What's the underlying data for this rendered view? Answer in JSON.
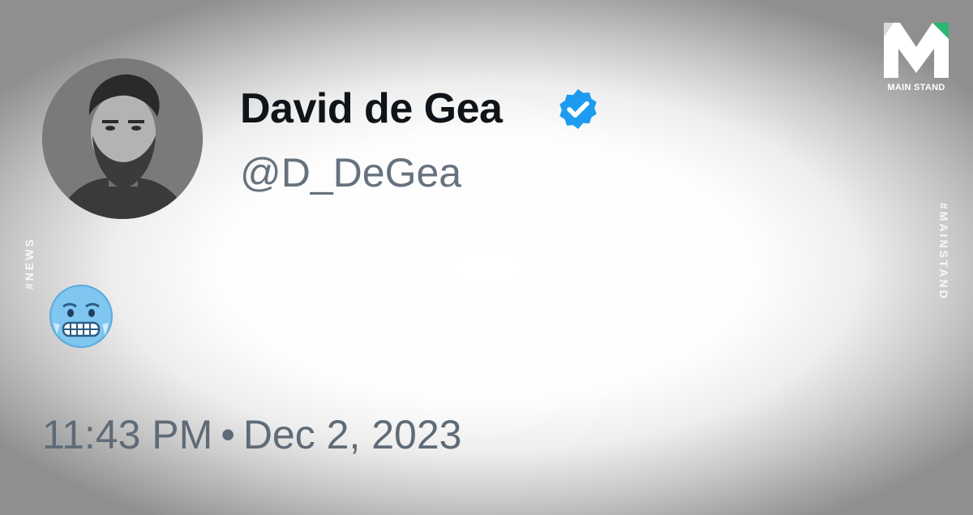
{
  "tweet": {
    "display_name": "David de Gea",
    "handle": "@D_DeGea",
    "body_emoji": "cold-face-emoji",
    "time": "11:43 PM",
    "separator": "•",
    "date": "Dec 2, 2023"
  },
  "icons": {
    "verified": "verified-badge-icon",
    "avatar": "profile-photo"
  },
  "watermark": {
    "left_tag": "#NEWS",
    "right_tag": "#MAINSTAND",
    "logo_text": "MAIN STAND"
  },
  "colors": {
    "name": "#0f1419",
    "handle": "#66727e",
    "timestamp": "#5f6b77",
    "verified_blue": "#1d9bf0",
    "logo_green": "#2bb673"
  }
}
